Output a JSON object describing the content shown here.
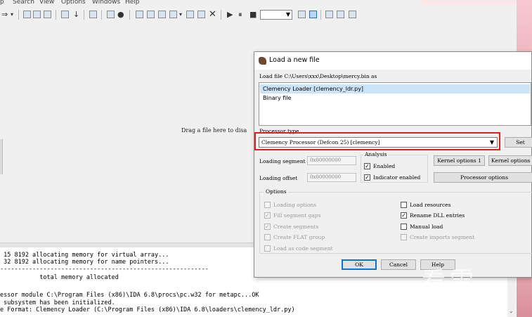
{
  "menubar": {
    "items": [
      "p",
      "Search",
      "View",
      "Options",
      "Windows",
      "Help"
    ]
  },
  "workspace": {
    "drag_hint": "Drag a file here to disa"
  },
  "output": {
    "lines": [
      " 15 8192 allocating memory for virtual array...",
      " 32 8192 allocating memory for name pointers...",
      "----------------------------------------------------------",
      "           total memory allocated",
      "",
      "essor module C:\\Program Files (x86)\\IDA 6.8\\procs\\pc.w32 for metapc...OK",
      " subsystem has been initialized.",
      "e Format: Clemency Loader (C:\\Program Files (x86)\\IDA 6.8\\loaders\\clemency_ldr.py)"
    ]
  },
  "watermark": "看雪",
  "dialog": {
    "title": "Load a new file",
    "load_file_label": "Load file C:\\Users\\xxx\\Desktop\\mercy.bin as",
    "loader_list": [
      {
        "label": "Clemency Loader [clemency_ldr.py]",
        "selected": true
      },
      {
        "label": "Binary file",
        "selected": false
      }
    ],
    "processor_type_label": "Processor type",
    "processor_selected": "Clemency Processor (Defcon 25) [clemency]",
    "set_button": "Set",
    "loading_segment_label": "Loading segment",
    "loading_segment_value": "0x00000000",
    "loading_offset_label": "Loading offset",
    "loading_offset_value": "0x00000000",
    "analysis": {
      "legend": "Analysis",
      "enabled_label": "Enabled",
      "enabled_checked": true,
      "indicator_label": "Indicator enabled",
      "indicator_checked": true
    },
    "kernel_options_1": "Kernel options 1",
    "kernel_options_2": "Kernel options",
    "processor_options": "Processor options",
    "options": {
      "legend": "Options",
      "left": [
        {
          "label": "Loading options",
          "checked": false,
          "disabled": true
        },
        {
          "label": "Fill segment gaps",
          "checked": true,
          "disabled": true
        },
        {
          "label": "Create segments",
          "checked": true,
          "disabled": true
        },
        {
          "label": "Create FLAT group",
          "checked": false,
          "disabled": true
        },
        {
          "label": "Load as code segment",
          "checked": false,
          "disabled": true
        }
      ],
      "right": [
        {
          "label": "Load resources",
          "checked": false,
          "disabled": false
        },
        {
          "label": "Rename DLL entries",
          "checked": true,
          "disabled": false
        },
        {
          "label": "Manual load",
          "checked": false,
          "disabled": false
        },
        {
          "label": "Create imports segment",
          "checked": false,
          "disabled": true
        }
      ]
    },
    "ok_button": "OK",
    "cancel_button": "Cancel",
    "help_button": "Help"
  },
  "colors": {
    "highlight": "#e02020",
    "selection": "#cce4f7",
    "default_button": "#0078d7"
  },
  "icons": {
    "title": "ida-icon",
    "check": "checkmark-icon",
    "dropdown": "chevron-down-icon"
  }
}
